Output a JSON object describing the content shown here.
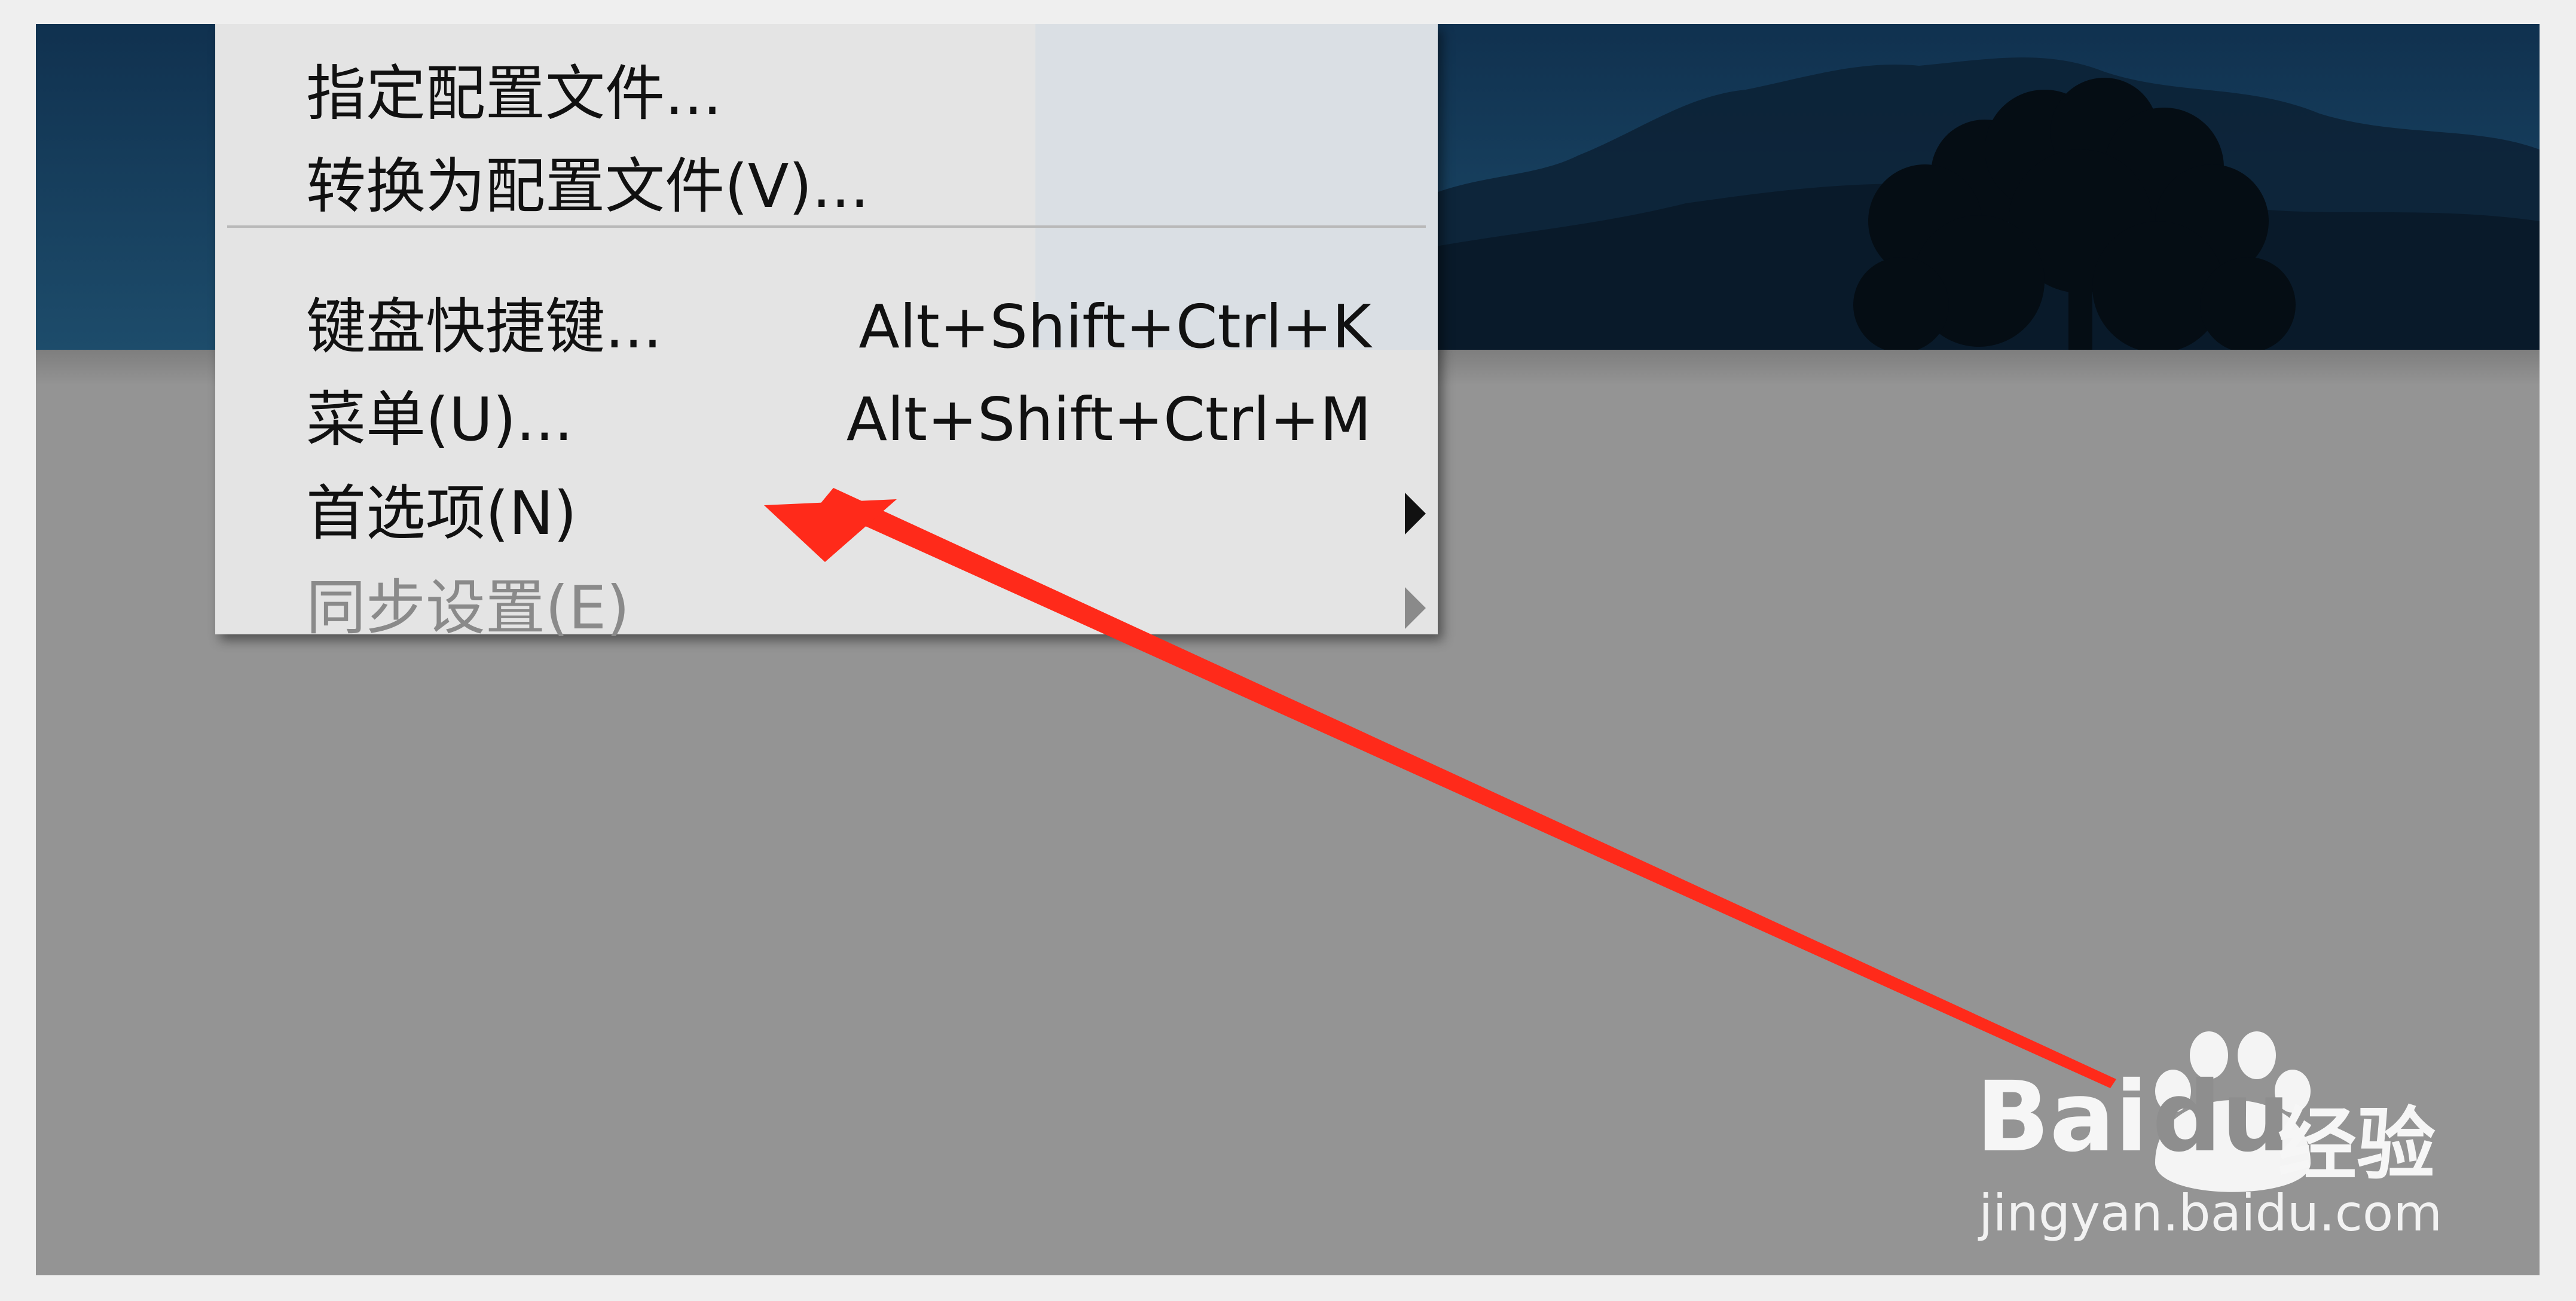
{
  "menu": {
    "items": [
      {
        "label": "指定配置文件...",
        "shortcut": "",
        "submenu": false,
        "disabled": false
      },
      {
        "label": "转换为配置文件(V)...",
        "shortcut": "",
        "submenu": false,
        "disabled": false
      },
      {
        "label": "键盘快捷键...",
        "shortcut": "Alt+Shift+Ctrl+K",
        "submenu": false,
        "disabled": false
      },
      {
        "label": "菜单(U)...",
        "shortcut": "Alt+Shift+Ctrl+M",
        "submenu": false,
        "disabled": false
      },
      {
        "label": "首选项(N)",
        "shortcut": "",
        "submenu": true,
        "disabled": false
      },
      {
        "label": "同步设置(E)",
        "shortcut": "",
        "submenu": true,
        "disabled": true
      }
    ]
  },
  "annotation": {
    "arrow_color": "#ff2a1a"
  },
  "watermark": {
    "brand_left": "Bai",
    "brand_paw": "du",
    "brand_cn": "经验",
    "url": "jingyan.baidu.com"
  },
  "colors": {
    "canvas": "#949494",
    "menu_bg": "#e4e4e4",
    "disabled_text": "#8a8a8a",
    "sky_top": "#0e2c48",
    "sky_bottom": "#1c4b6c"
  }
}
